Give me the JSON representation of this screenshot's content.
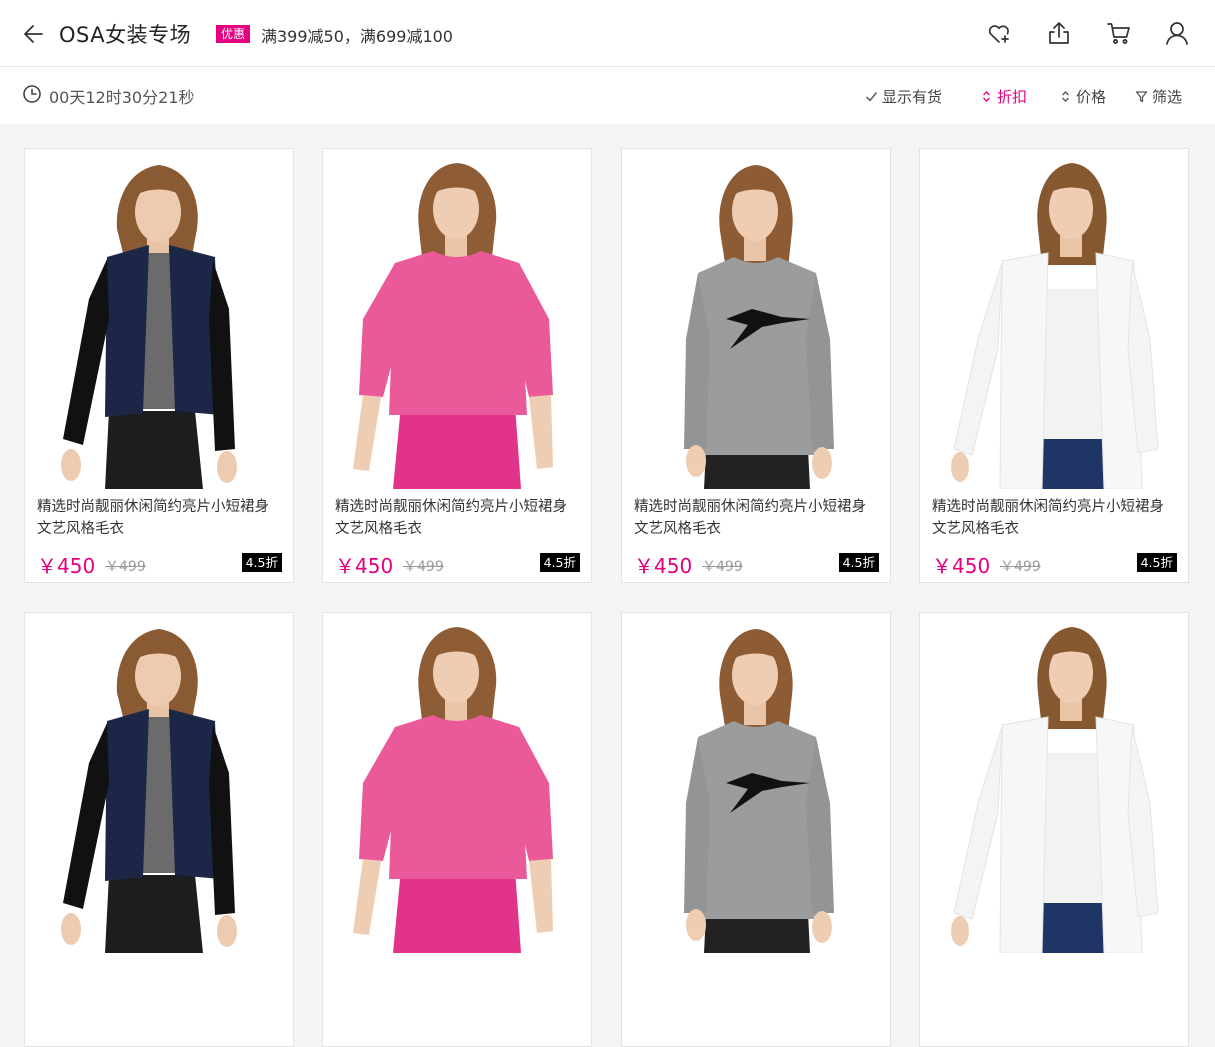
{
  "header": {
    "title": "OSA女装专场",
    "promo_badge": "优惠",
    "promo_text": "满399减50，满699减100"
  },
  "icons": {
    "back": "arrow-left-icon",
    "favorite": "heart-plus-icon",
    "share": "share-icon",
    "cart": "cart-icon",
    "user": "user-icon",
    "clock": "clock-icon",
    "check": "check-icon",
    "sort": "sort-arrows-icon",
    "filter": "funnel-icon"
  },
  "subbar": {
    "countdown": "00天12时30分21秒",
    "filters": [
      {
        "label": "显示有货",
        "active": false
      },
      {
        "label": "折扣",
        "active": true
      },
      {
        "label": "价格",
        "active": false
      },
      {
        "label": "筛选",
        "active": false
      }
    ]
  },
  "colors": {
    "accent": "#e4007f",
    "navy_jacket": "#1c2647",
    "pink_top": "#ea5a9a",
    "grey_sweater": "#9c9c9c",
    "white_cardigan": "#f7f7f7"
  },
  "products": [
    {
      "name": "精选时尚靓丽休闲简约亮片小短裙身文艺风格毛衣",
      "price": "￥450",
      "original_price": "￥499",
      "discount": "4.5折",
      "style": "navy-jacket"
    },
    {
      "name": "精选时尚靓丽休闲简约亮片小短裙身文艺风格毛衣",
      "price": "￥450",
      "original_price": "￥499",
      "discount": "4.5折",
      "style": "pink-top"
    },
    {
      "name": "精选时尚靓丽休闲简约亮片小短裙身文艺风格毛衣",
      "price": "￥450",
      "original_price": "￥499",
      "discount": "4.5折",
      "style": "grey-sweater"
    },
    {
      "name": "精选时尚靓丽休闲简约亮片小短裙身文艺风格毛衣",
      "price": "￥450",
      "original_price": "￥499",
      "discount": "4.5折",
      "style": "white-cardigan"
    },
    {
      "name": "",
      "price": "",
      "original_price": "",
      "discount": "",
      "style": "navy-jacket"
    },
    {
      "name": "",
      "price": "",
      "original_price": "",
      "discount": "",
      "style": "pink-top"
    },
    {
      "name": "",
      "price": "",
      "original_price": "",
      "discount": "",
      "style": "grey-sweater"
    },
    {
      "name": "",
      "price": "",
      "original_price": "",
      "discount": "",
      "style": "white-cardigan"
    }
  ]
}
